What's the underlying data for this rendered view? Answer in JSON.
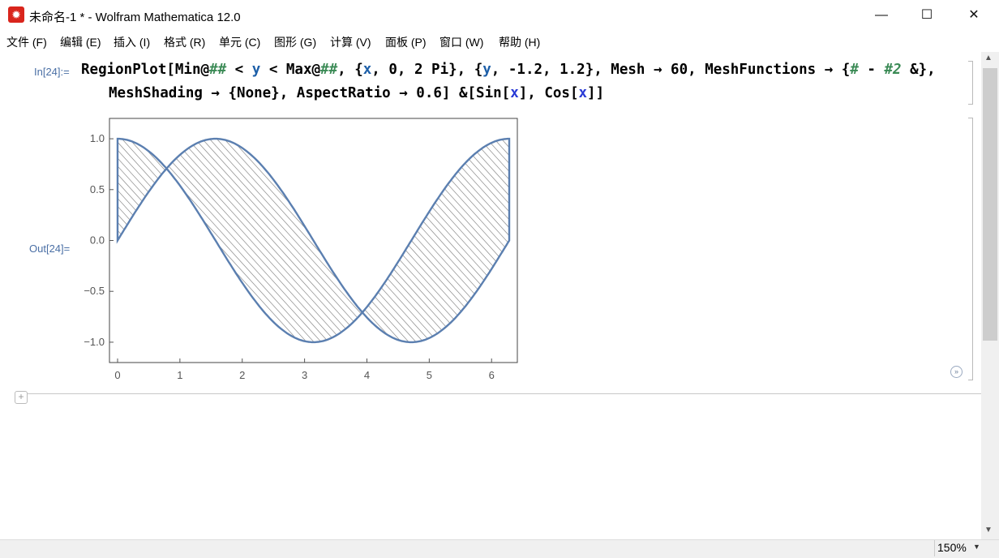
{
  "window": {
    "title": "未命名-1 * - Wolfram Mathematica 12.0",
    "app_icon": "mathematica-spikey-icon",
    "controls": {
      "minimize": "—",
      "maximize": "☐",
      "close": "✕"
    }
  },
  "menu": [
    "文件 (F)",
    "编辑 (E)",
    "插入 (I)",
    "格式 (R)",
    "单元 (C)",
    "图形 (G)",
    "计算 (V)",
    "面板 (P)",
    "窗口 (W)",
    "帮助 (H)"
  ],
  "notebook": {
    "input_label": "In[24]:=",
    "output_label": "Out[24]=",
    "input_line1": "RegionPlot[Min@## < y < Max@##, {x, 0, 2 Pi}, {y, -1.2, 1.2}, Mesh → 60, MeshFunctions → {# - #2 &},",
    "input_line2": "MeshShading → {None}, AspectRatio → 0.6] &[Sin[x], Cos[x]]"
  },
  "chart_data": {
    "type": "area",
    "description_series": "region between sin(x) and cos(x)",
    "series": [
      {
        "values_function": "sin(x)"
      },
      {
        "values_function": "cos(x)"
      }
    ],
    "x_range": [
      0,
      6.2832
    ],
    "y_range": [
      -1.2,
      1.2
    ],
    "xticks": [
      "0",
      "1",
      "2",
      "3",
      "4",
      "5",
      "6"
    ],
    "yticks": [
      "1.0",
      "0.5",
      "0.0",
      "−0.5",
      "−1.0"
    ],
    "mesh_lines": 60,
    "fill": "hatched",
    "line_color": "#5b7fb0"
  },
  "status": {
    "zoom": "150%"
  },
  "colors": {
    "accent": "#5b7fb0",
    "label": "#4a6fa5"
  }
}
